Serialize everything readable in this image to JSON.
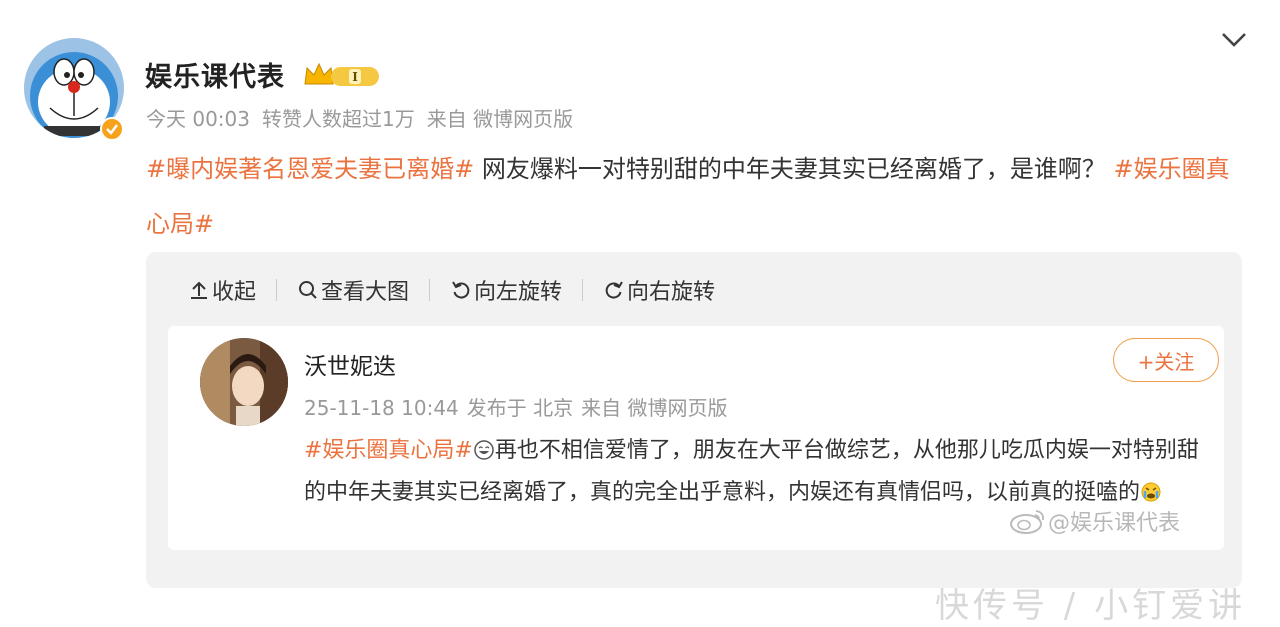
{
  "post": {
    "author": "娱乐课代表",
    "meta": {
      "time": "今天 00:03",
      "reposts": "转赞人数超过1万",
      "source": "来自 微博网页版"
    },
    "text_parts": {
      "tag1": "#曝内娱著名恩爱夫妻已离婚#",
      "body": " 网友爆料一对特别甜的中年夫妻其实已经离婚了，是谁啊？ ",
      "tag2": "#娱乐圈真心局#"
    }
  },
  "toolbar": {
    "collapse": "收起",
    "view_large": "查看大图",
    "rotate_left": "向左旋转",
    "rotate_right": "向右旋转"
  },
  "embedded": {
    "author": "沃世妮迭",
    "meta": {
      "time": "25-11-18 10:44",
      "location": "发布于 北京",
      "source": "来自 微博网页版"
    },
    "follow": "+关注",
    "text_parts": {
      "tag": "#娱乐圈真心局#",
      "body": "再也不相信爱情了，朋友在大平台做综艺，从他那儿吃瓜内娱一对特别甜的中年夫妻其实已经离婚了，真的完全出乎意料，内娱还有真情侣吗，以前真的挺嗑的"
    },
    "watermark": "@娱乐课代表"
  },
  "watermark_bottom": "快传号 / 小钉爱讲",
  "colors": {
    "tag": "#eb7340",
    "meta": "#999999",
    "panel": "#f2f2f2",
    "follow_border": "#f39c45"
  },
  "icons": [
    "chevron-down-icon",
    "crown-badge-icon",
    "verified-icon",
    "upload-arrow-icon",
    "search-icon",
    "rotate-left-icon",
    "rotate-right-icon",
    "grin-emoji-icon",
    "cry-emoji-icon",
    "weibo-logo-icon"
  ]
}
